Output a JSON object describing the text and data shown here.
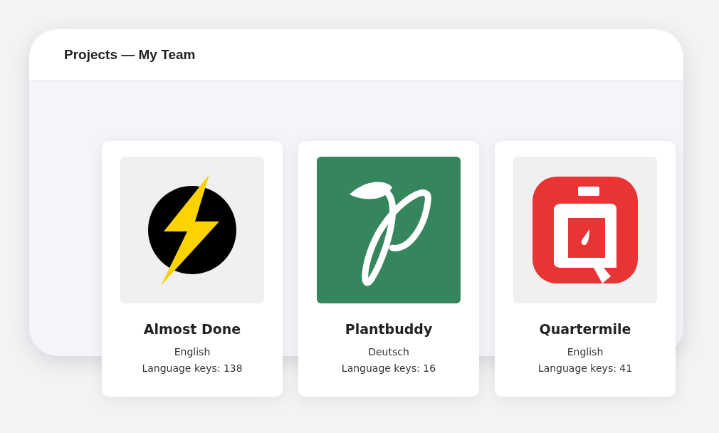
{
  "window": {
    "title": "Projects — My Team"
  },
  "projects": [
    {
      "name": "Almost Done",
      "logo": {
        "kind": "bolt"
      },
      "language": "English",
      "keys": "Language keys: 138"
    },
    {
      "name": "Plantbuddy",
      "logo": {
        "kind": "plant"
      },
      "language": "Deutsch",
      "keys": "Language keys: 16"
    },
    {
      "name": "Quartermile",
      "logo": {
        "kind": "timer"
      },
      "language": "English",
      "keys": "Language keys: 41"
    }
  ]
}
